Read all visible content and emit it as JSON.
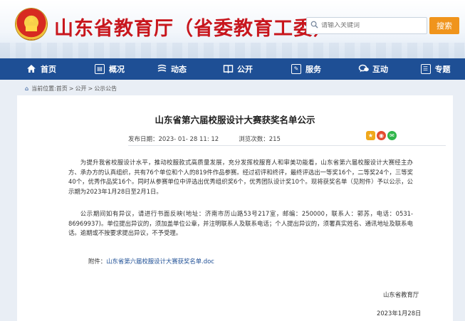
{
  "header": {
    "site_title": "山东省教育厅（省委教育工委）",
    "search_placeholder": "请输入关键词",
    "search_button": "搜索"
  },
  "nav": {
    "items": [
      {
        "label": "首页",
        "icon": "home-icon"
      },
      {
        "label": "概况",
        "icon": "overview-icon"
      },
      {
        "label": "动态",
        "icon": "news-icon"
      },
      {
        "label": "公开",
        "icon": "book-icon"
      },
      {
        "label": "服务",
        "icon": "service-icon"
      },
      {
        "label": "互动",
        "icon": "chat-icon"
      },
      {
        "label": "专题",
        "icon": "topic-icon"
      }
    ]
  },
  "breadcrumb": {
    "prefix": "当前位置:",
    "items": [
      "首页",
      "公开",
      "公示公告"
    ],
    "separator": ">"
  },
  "article": {
    "title": "山东省第六届校服设计大赛获奖名单公示",
    "publish_label": "发布日期：",
    "publish_date": "2023- 01- 28 11: 12",
    "views_label": "浏览次数：",
    "views": "215",
    "paragraph1": "为提升我省校服设计水平，推动校服款式高质量发展，充分发挥校服育人和审美功能看，山东省第六届校服设计大赛经主办方、承办方的认真组织，共有76个单位和个人的819件作品参赛。经过初评和终评，最终评选出一等奖16个，二等奖24个，三等奖40个，优秀作品奖16个。同时从参赛单位中评选出优秀组织奖6个，优秀团队设计奖10个。现将获奖名单（见附件）予以公示，公示期为2023年1月28日至2月1日。",
    "paragraph2": "公示期间如有异议，请进行书面反映(地址：济南市历山路53号217室，邮编：250000，联系人：郭苏，电话：0531-86969937)。单位提出异议的，须加盖单位公章，并注明联系人及联系电话；个人提出异议的，须署真实姓名、通讯地址及联系电话。逾期或不按要求提出异议，不予受理。",
    "attachment_label": "附件：",
    "attachment_link": "山东省第六届校服设计大赛获奖名单.doc",
    "signature_org": "山东省教育厅",
    "signature_date": "2023年1月28日"
  },
  "colors": {
    "nav_bg": "#1e4f95",
    "title_red": "#c8161d",
    "search_button": "#f0941c",
    "page_bg": "#e9eef5"
  }
}
